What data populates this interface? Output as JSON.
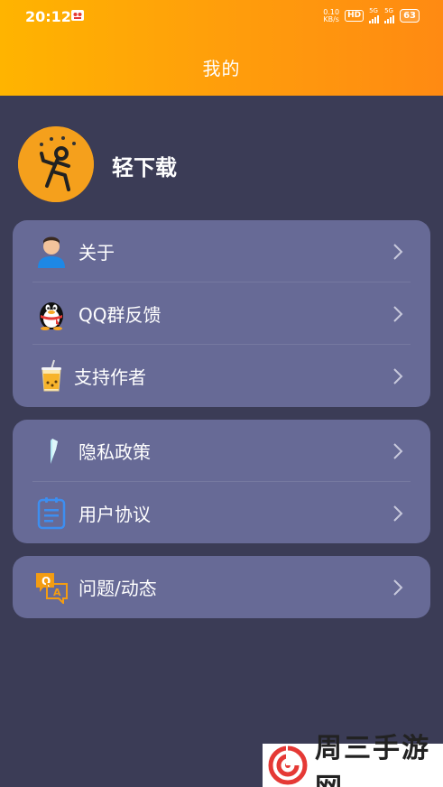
{
  "status_bar": {
    "time": "20:12",
    "net_speed_value": "0.10",
    "net_speed_unit": "KB/s",
    "hd_label": "HD",
    "signal_1": "5G",
    "signal_2": "5G",
    "battery": "63"
  },
  "header": {
    "title": "我的",
    "accent_start": "#ffb400",
    "accent_end": "#ff8a12"
  },
  "profile": {
    "name": "轻下载"
  },
  "menu_group_1": [
    {
      "label": "关于",
      "icon": "user-avatar-icon"
    },
    {
      "label": "QQ群反馈",
      "icon": "qq-penguin-icon"
    },
    {
      "label": "支持作者",
      "icon": "drink-cup-icon"
    }
  ],
  "menu_group_2": [
    {
      "label": "隐私政策",
      "icon": "privacy-icon"
    },
    {
      "label": "用户协议",
      "icon": "clipboard-icon"
    }
  ],
  "menu_group_3": [
    {
      "label": "问题/动态",
      "icon": "qa-chat-icon"
    }
  ],
  "watermark": {
    "text": "周三手游网"
  },
  "colors": {
    "background": "#3b3c56",
    "card": "#676a96"
  }
}
